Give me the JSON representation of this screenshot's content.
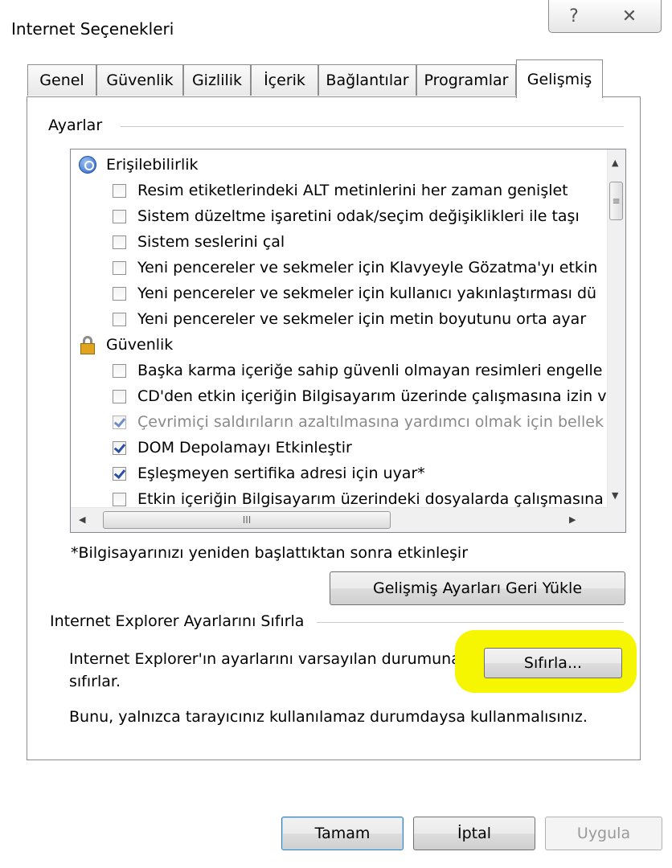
{
  "window": {
    "title": "Internet Seçenekleri",
    "help_glyph": "?",
    "close_glyph": "✕"
  },
  "tabs": [
    {
      "label": "Genel",
      "active": false
    },
    {
      "label": "Güvenlik",
      "active": false
    },
    {
      "label": "Gizlilik",
      "active": false
    },
    {
      "label": "İçerik",
      "active": false
    },
    {
      "label": "Bağlantılar",
      "active": false
    },
    {
      "label": "Programlar",
      "active": false
    },
    {
      "label": "Gelişmiş",
      "active": true
    }
  ],
  "settings": {
    "group_label": "Ayarlar",
    "rows": [
      {
        "type": "category",
        "icon": "accessibility-icon",
        "label": "Erişilebilirlik"
      },
      {
        "type": "checkbox",
        "checked": false,
        "enabled": true,
        "label": "Resim etiketlerindeki ALT metinlerini her zaman genişlet"
      },
      {
        "type": "checkbox",
        "checked": false,
        "enabled": true,
        "label": "Sistem düzeltme işaretini odak/seçim değişiklikleri ile taşı"
      },
      {
        "type": "checkbox",
        "checked": false,
        "enabled": true,
        "label": "Sistem seslerini çal"
      },
      {
        "type": "checkbox",
        "checked": false,
        "enabled": true,
        "label": "Yeni pencereler ve sekmeler için Klavyeyle Gözatma'yı etkin"
      },
      {
        "type": "checkbox",
        "checked": false,
        "enabled": true,
        "label": "Yeni pencereler ve sekmeler için kullanıcı yakınlaştırması dü"
      },
      {
        "type": "checkbox",
        "checked": false,
        "enabled": true,
        "label": "Yeni pencereler ve sekmeler için metin boyutunu orta ayar"
      },
      {
        "type": "category",
        "icon": "lock-icon",
        "label": "Güvenlik"
      },
      {
        "type": "checkbox",
        "checked": false,
        "enabled": true,
        "label": "Başka karma içeriğe sahip güvenli olmayan resimleri engelle"
      },
      {
        "type": "checkbox",
        "checked": false,
        "enabled": true,
        "label": "CD'den etkin içeriğin Bilgisayarım üzerinde çalışmasına izin v"
      },
      {
        "type": "checkbox",
        "checked": true,
        "enabled": false,
        "label": "Çevrimiçi saldırıların azaltılmasına yardımcı olmak için bellek"
      },
      {
        "type": "checkbox",
        "checked": true,
        "enabled": true,
        "label": "DOM Depolamayı Etkinleştir"
      },
      {
        "type": "checkbox",
        "checked": true,
        "enabled": true,
        "label": "Eşleşmeyen sertifika adresi için uyar*"
      },
      {
        "type": "checkbox",
        "checked": false,
        "enabled": true,
        "label": "Etkin içeriğin Bilgisayarım üzerindeki dosyalarda çalışmasına"
      }
    ],
    "restart_note": "*Bilgisayarınızı yeniden başlattıktan sonra etkinleşir",
    "restore_button": "Gelişmiş Ayarları Geri Yükle"
  },
  "reset": {
    "group_label": "Internet Explorer Ayarlarını Sıfırla",
    "description_line1": "Internet Explorer'ın ayarlarını varsayılan durumuna",
    "description_line2": "sıfırlar.",
    "button": "Sıfırla...",
    "warning": "Bunu, yalnızca tarayıcınız kullanılamaz durumdaysa kullanmalısınız.",
    "highlight_color": "#f6f600"
  },
  "footer": {
    "ok": "Tamam",
    "cancel": "İptal",
    "apply": "Uygula"
  },
  "scroll_glyphs": {
    "up": "▲",
    "down": "▼",
    "left": "◀",
    "right": "▶",
    "grip_v": "≡",
    "grip_h": "III"
  }
}
